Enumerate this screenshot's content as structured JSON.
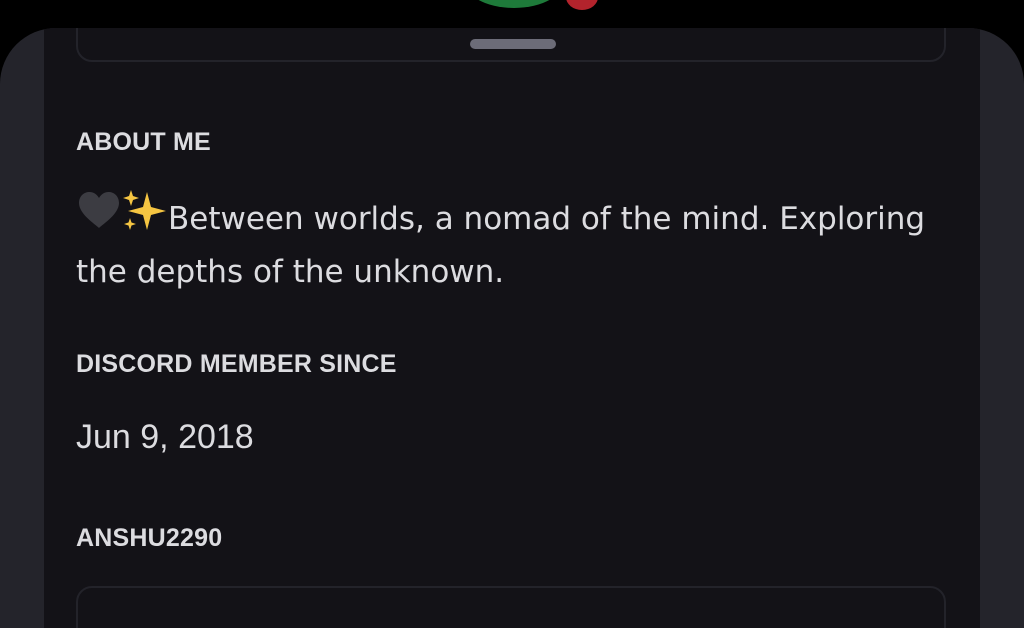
{
  "profile": {
    "about_heading": "ABOUT ME",
    "about_text": "Between worlds, a nomad of the mind. Exploring the depths of the unknown.",
    "about_emoji": [
      "black-heart",
      "sparkles"
    ],
    "member_since_heading": "DISCORD MEMBER SINCE",
    "member_since_value": "Jun 9, 2018",
    "username_heading": "ANSHU2290"
  },
  "colors": {
    "background": "#000000",
    "sheet": "#24242b",
    "panel": "#131217",
    "text": "#dcdce0",
    "handle": "#6c6c78",
    "avatar": "#1e7a3a",
    "status": "#b3232c",
    "sparkles": "#f5c542"
  }
}
